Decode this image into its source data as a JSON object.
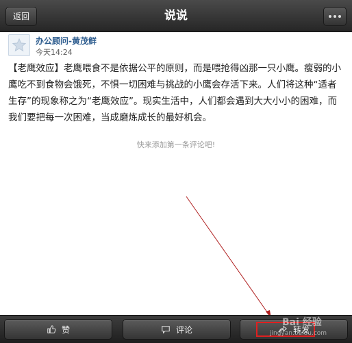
{
  "header": {
    "back_label": "返回",
    "title": "说说"
  },
  "post": {
    "author": "办公顾问-黄茂鲜",
    "time": "今天14:24",
    "body": "【老鹰效应】老鹰喂食不是依据公平的原则，而是喂抢得凶那一只小鹰。瘦弱的小鹰吃不到食物会饿死，不惧一切困难与挑战的小鹰会存活下来。人们将这种“适者生存”的现象称之为“老鹰效应”。现实生活中，人们都会遇到大大小小的困难，而我们要把每一次困难，当成磨炼成长的最好机会。"
  },
  "comments": {
    "empty_hint": "快来添加第一条评论吧!"
  },
  "toolbar": {
    "like_label": "赞",
    "comment_label": "评论",
    "forward_label": "转发"
  },
  "watermark": {
    "text": "Bai 经验",
    "sub": "jingyan.baidu.com"
  },
  "colors": {
    "author": "#2e5d8f",
    "annotation": "#e02020"
  }
}
